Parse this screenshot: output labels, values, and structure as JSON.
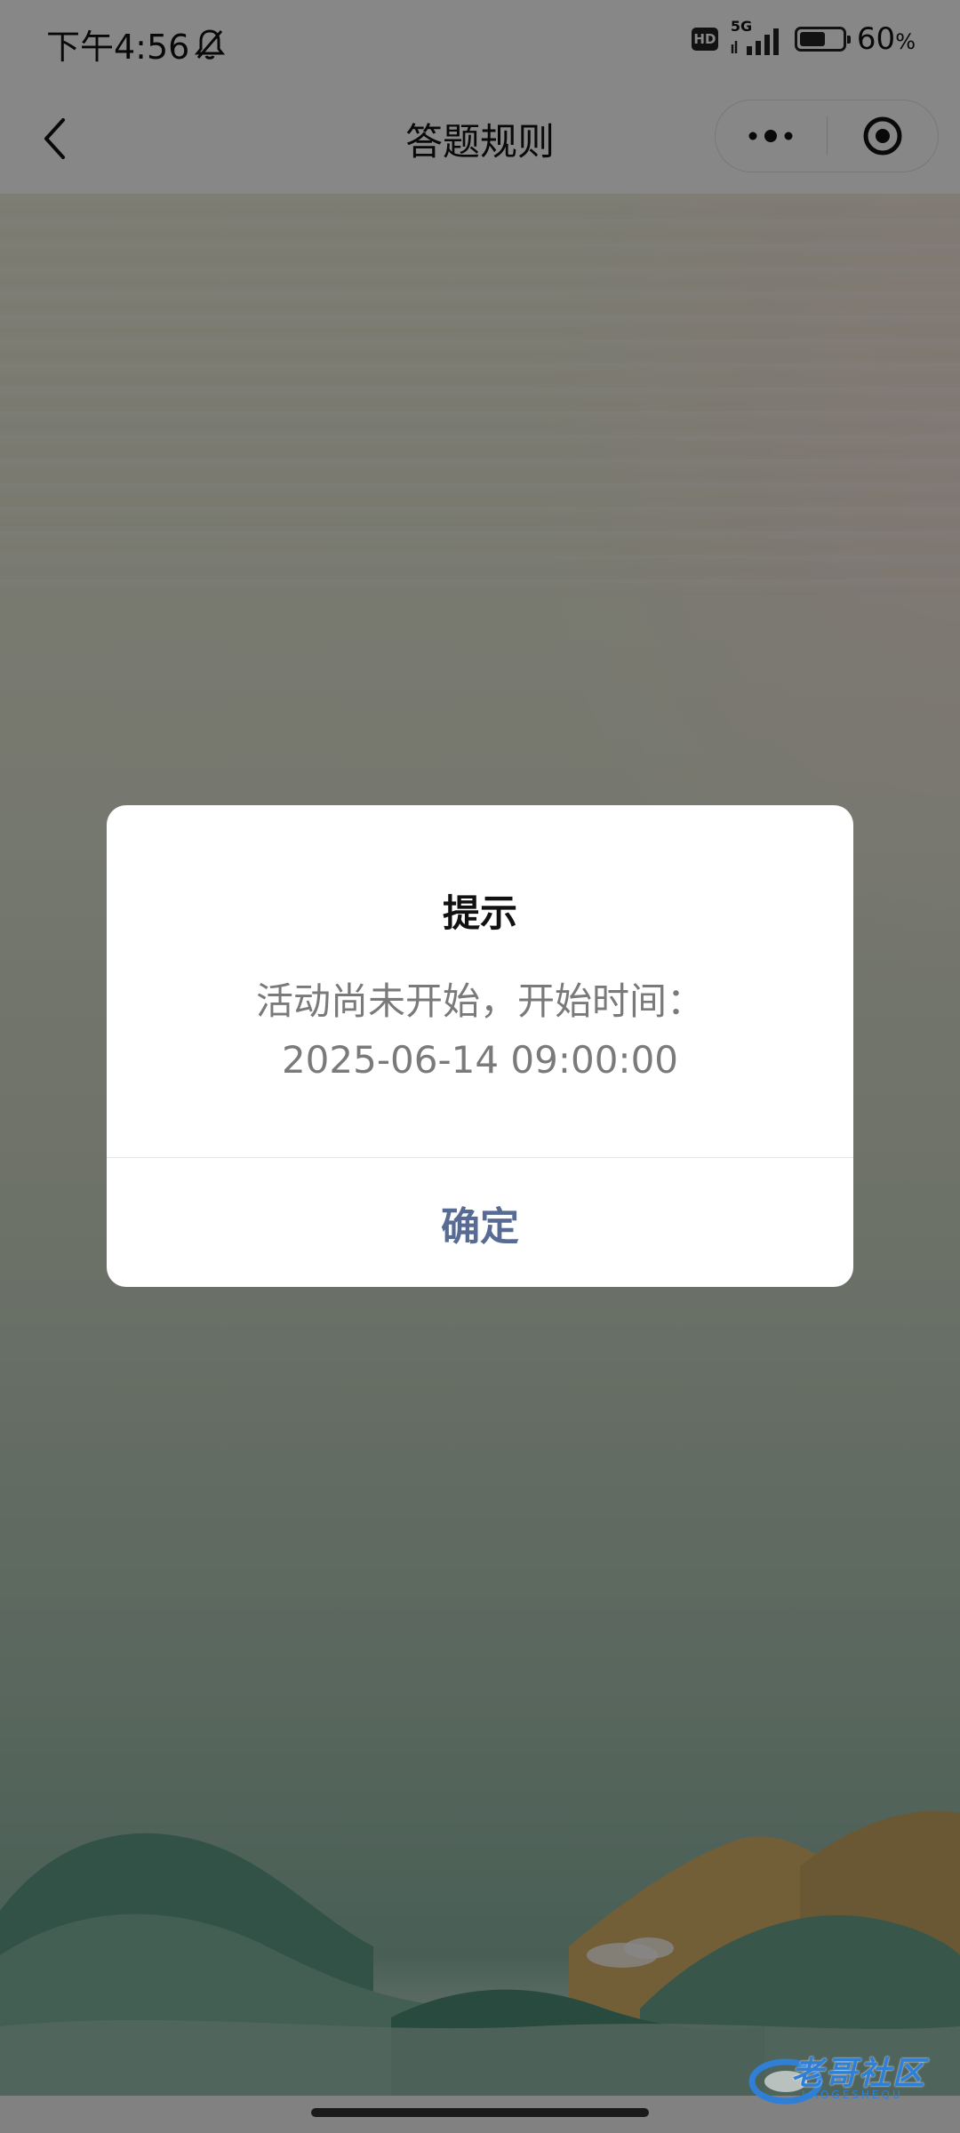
{
  "status_bar": {
    "time": "下午4:56",
    "silent_icon": "bell-off-icon",
    "hd_label": "HD",
    "network_label": "5G",
    "battery_level": 0.6,
    "battery_label": "60",
    "battery_unit": "%"
  },
  "nav": {
    "back_icon": "chevron-left-icon",
    "title": "答题规则",
    "more_icon": "more-dots-icon",
    "close_icon": "target-circle-icon"
  },
  "dialog": {
    "title": "提示",
    "message_line1": "活动尚未开始，开始时间：",
    "message_line2": "2025-06-14 09:00:00",
    "confirm_label": "确定"
  },
  "watermark": {
    "text": "老哥社区",
    "subtext": "LAOGESHEQU"
  },
  "colors": {
    "dialog_button": "#576b95",
    "mask": "rgba(0,0,0,0.47)",
    "watermark": "#2f7fd6"
  }
}
